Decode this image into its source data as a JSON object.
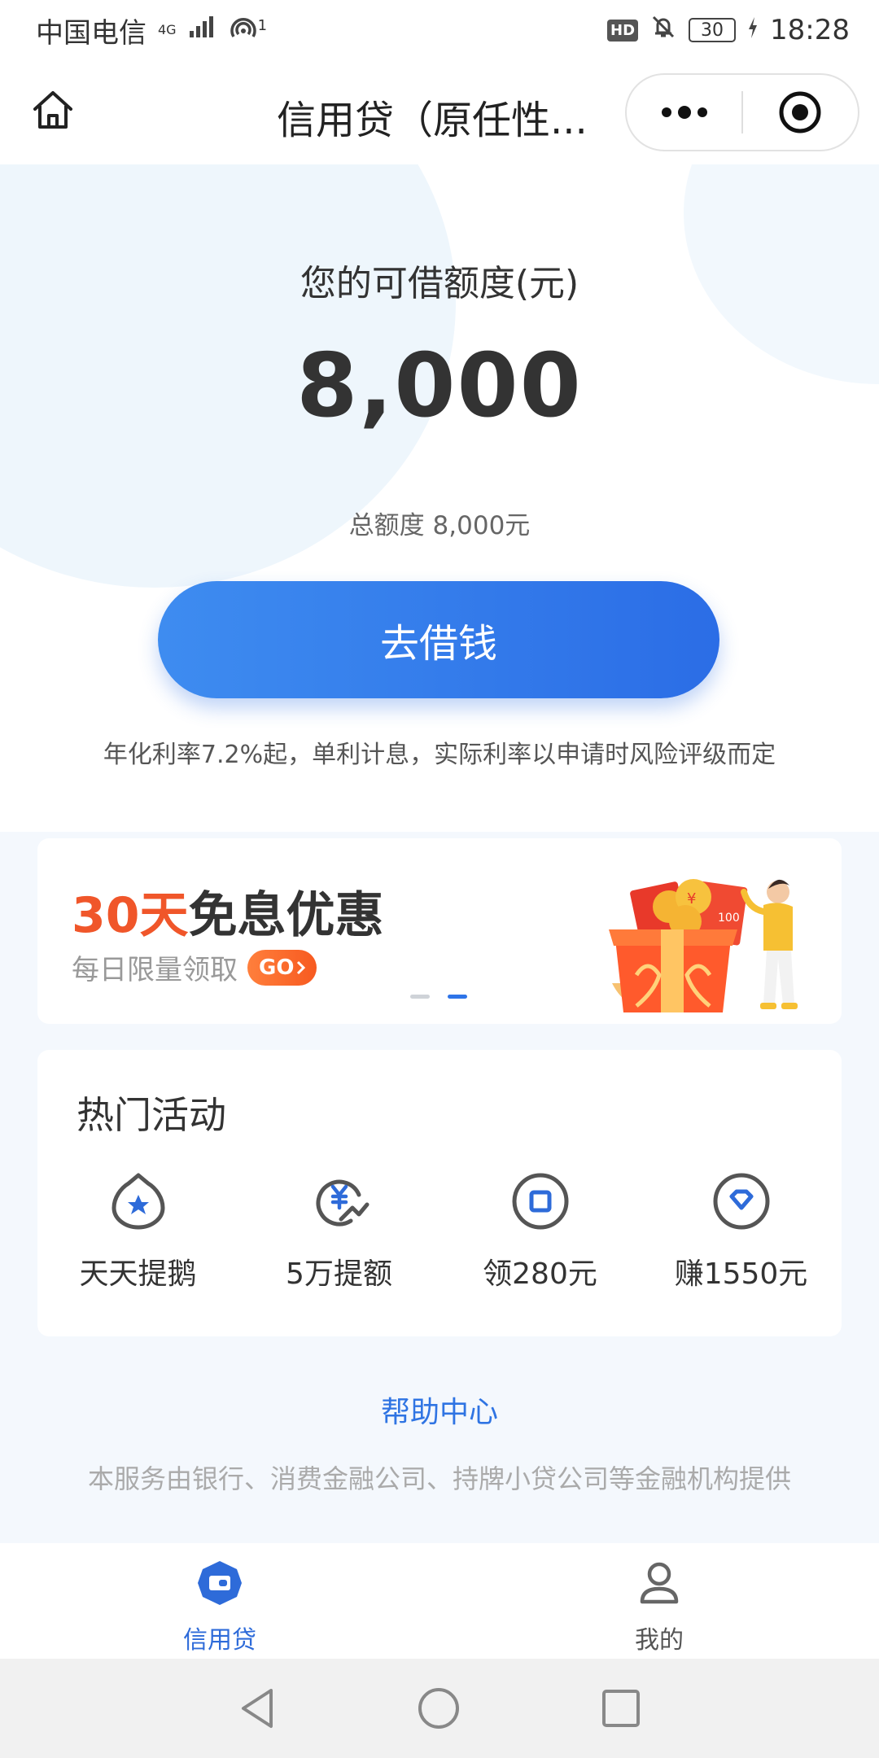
{
  "status_bar": {
    "carrier": "中国电信",
    "network_top": "4G",
    "hotspot_sup": "1",
    "battery": "30",
    "time": "18:28",
    "hd": "HD"
  },
  "nav": {
    "title": "信用贷（原任性..."
  },
  "hero": {
    "credit_label": "您的可借额度(元)",
    "credit_amount": "8,000",
    "total_line": "总额度 8,000元",
    "borrow_button": "去借钱",
    "rate_note": "年化利率7.2%起，单利计息，实际利率以申请时风险评级而定"
  },
  "banner": {
    "title_accent": "30天",
    "title_rest": "免息优惠",
    "subtitle": "每日限量领取",
    "go_label": "GO",
    "slides_total": 2,
    "active_slide": 2
  },
  "activities": {
    "title": "热门活动",
    "items": [
      {
        "label": "天天提鹅",
        "icon": "star-icon"
      },
      {
        "label": "5万提额",
        "icon": "yen-up-icon"
      },
      {
        "label": "领280元",
        "icon": "square-icon"
      },
      {
        "label": "赚1550元",
        "icon": "heart-diamond-icon"
      }
    ]
  },
  "footer": {
    "help_link": "帮助中心",
    "service_note": "本服务由银行、消费金融公司、持牌小贷公司等金融机构提供"
  },
  "tabs": [
    {
      "label": "信用贷",
      "icon": "wallet-icon",
      "active": true
    },
    {
      "label": "我的",
      "icon": "user-icon",
      "active": false
    }
  ],
  "colors": {
    "primary": "#2e6bd9",
    "button_start": "#3e8cf0",
    "button_end": "#2b6de6",
    "accent_orange": "#f0562a",
    "link_blue": "#2f74e3"
  }
}
